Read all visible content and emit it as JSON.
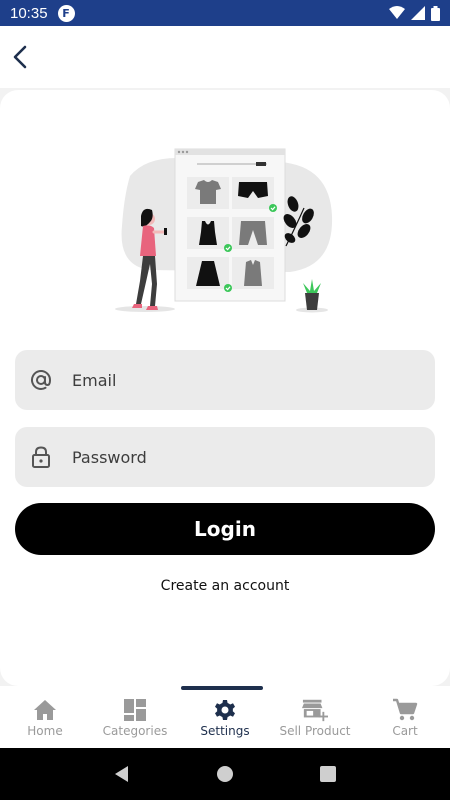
{
  "status_bar": {
    "time": "10:35",
    "app_icon": "F"
  },
  "app_bar": {
    "back_icon": "chevron-left-icon"
  },
  "login": {
    "email_placeholder": "Email",
    "password_placeholder": "Password",
    "login_label": "Login",
    "create_account_label": "Create an account"
  },
  "bottom_nav": {
    "items": [
      {
        "label": "Home",
        "icon": "home-icon",
        "active": false
      },
      {
        "label": "Categories",
        "icon": "categories-icon",
        "active": false
      },
      {
        "label": "Settings",
        "icon": "gear-icon",
        "active": true
      },
      {
        "label": "Sell Product",
        "icon": "store-add-icon",
        "active": false
      },
      {
        "label": "Cart",
        "icon": "cart-icon",
        "active": false
      }
    ]
  },
  "colors": {
    "status_bar": "#1e3f8a",
    "primary_dark": "#1e2f4d",
    "button": "#000000",
    "field_bg": "#ebebeb",
    "inactive": "#9a9a9a"
  }
}
